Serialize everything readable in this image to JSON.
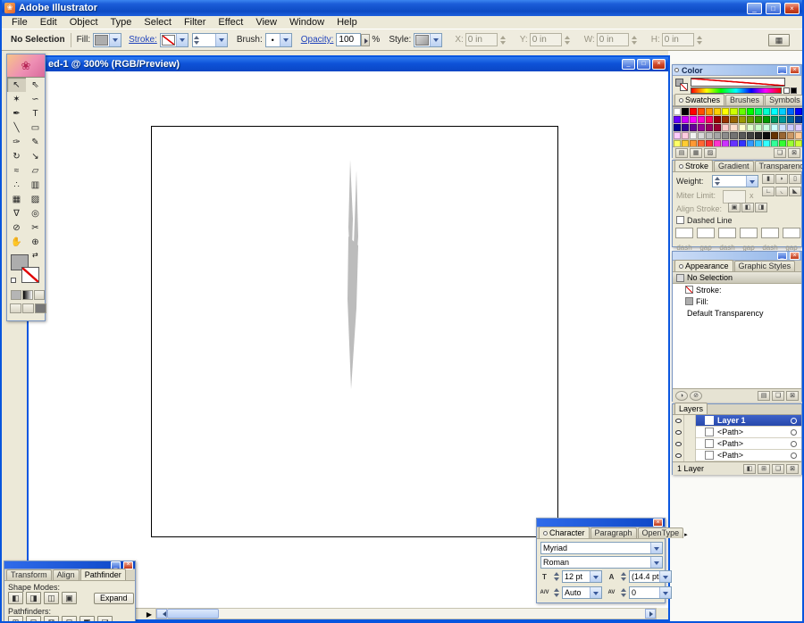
{
  "window": {
    "title": "Adobe Illustrator"
  },
  "glyphs": {
    "minimize": "_",
    "restore": "□",
    "close": "×",
    "play": "▶",
    "flower": "❀",
    "swap": "⇄",
    "panel_arrow": "▸",
    "panel": "▦"
  },
  "menu": {
    "items": [
      "File",
      "Edit",
      "Object",
      "Type",
      "Select",
      "Filter",
      "Effect",
      "View",
      "Window",
      "Help"
    ]
  },
  "control_bar": {
    "status": "No Selection",
    "fill_label": "Fill:",
    "stroke_label": "Stroke:",
    "brush_label": "Brush:",
    "brush_value": "•",
    "opacity_label": "Opacity:",
    "opacity_value": "100",
    "opacity_unit": "%",
    "style_label": "Style:",
    "fields": [
      {
        "label": "X:",
        "value": "0 in"
      },
      {
        "label": "Y:",
        "value": "0 in"
      },
      {
        "label": "W:",
        "value": "0 in"
      },
      {
        "label": "H:",
        "value": "0 in"
      }
    ]
  },
  "document": {
    "title": "ed-1 @ 300% (RGB/Preview)"
  },
  "colors": {
    "fill": "#ADADAD",
    "shape": "#BCBCBC"
  },
  "toolbox": {
    "tools": [
      {
        "name": "selection-tool-icon",
        "glyph": "↖"
      },
      {
        "name": "direct-selection-tool-icon",
        "glyph": "⇖"
      },
      {
        "name": "magic-wand-tool-icon",
        "glyph": "✶"
      },
      {
        "name": "lasso-tool-icon",
        "glyph": "∽"
      },
      {
        "name": "pen-tool-icon",
        "glyph": "✒"
      },
      {
        "name": "type-tool-icon",
        "glyph": "T"
      },
      {
        "name": "line-segment-tool-icon",
        "glyph": "╲"
      },
      {
        "name": "rectangle-tool-icon",
        "glyph": "▭"
      },
      {
        "name": "paintbrush-tool-icon",
        "glyph": "✑"
      },
      {
        "name": "pencil-tool-icon",
        "glyph": "✎"
      },
      {
        "name": "rotate-tool-icon",
        "glyph": "↻"
      },
      {
        "name": "scale-tool-icon",
        "glyph": "↘"
      },
      {
        "name": "warp-tool-icon",
        "glyph": "≈"
      },
      {
        "name": "free-transform-tool-icon",
        "glyph": "▱"
      },
      {
        "name": "symbol-sprayer-tool-icon",
        "glyph": "∴"
      },
      {
        "name": "column-graph-tool-icon",
        "glyph": "▥"
      },
      {
        "name": "mesh-tool-icon",
        "glyph": "▦"
      },
      {
        "name": "gradient-tool-icon",
        "glyph": "▨"
      },
      {
        "name": "eyedropper-tool-icon",
        "glyph": "∇"
      },
      {
        "name": "blend-tool-icon",
        "glyph": "◎"
      },
      {
        "name": "slice-tool-icon",
        "glyph": "⊘"
      },
      {
        "name": "scissors-tool-icon",
        "glyph": "✂"
      },
      {
        "name": "hand-tool-icon",
        "glyph": "✋"
      },
      {
        "name": "zoom-tool-icon",
        "glyph": "⊕"
      }
    ]
  },
  "color_panel": {
    "title": "Color"
  },
  "swatches_panel": {
    "tabs": [
      "Swatches",
      "Brushes",
      "Symbols"
    ],
    "icons": {
      "show_all": "▤",
      "show_color": "▦",
      "show_gradient": "▨",
      "new_swatch": "❏",
      "trash": "⊠"
    },
    "colors": [
      "#FFFFFF",
      "#000000",
      "#FF0000",
      "#FF4F00",
      "#FF9900",
      "#FFCE00",
      "#FFFF00",
      "#CEFF00",
      "#66FF00",
      "#00FF00",
      "#00FF66",
      "#00FFCE",
      "#00FFFF",
      "#00CEFF",
      "#0066FF",
      "#0000FF",
      "#6600FF",
      "#CE00FF",
      "#FF00FF",
      "#FF00CE",
      "#FF0066",
      "#990000",
      "#993300",
      "#996600",
      "#999900",
      "#669900",
      "#339900",
      "#009900",
      "#009966",
      "#009999",
      "#006699",
      "#003399",
      "#000099",
      "#330099",
      "#660099",
      "#990099",
      "#990066",
      "#990033",
      "#FFCCCC",
      "#FFE0CC",
      "#FFFFCC",
      "#E0FFCC",
      "#CCFFCC",
      "#CCFFE0",
      "#CCFFFF",
      "#CCE0FF",
      "#CCCCFF",
      "#E0CCFF",
      "#FFCCFF",
      "#FFCCE0",
      "#F2F2F2",
      "#D9D9D9",
      "#BFBFBF",
      "#A6A6A6",
      "#8C8C8C",
      "#737373",
      "#595959",
      "#404040",
      "#262626",
      "#0D0D0D",
      "#663300",
      "#996633",
      "#CC9966",
      "#FFCC99",
      "#FFFF66",
      "#FFCC33",
      "#FF9933",
      "#FF6633",
      "#FF3333",
      "#FF33CC",
      "#CC33FF",
      "#6633FF",
      "#3333FF",
      "#3399FF",
      "#33CCFF",
      "#33FFFF",
      "#33FF99",
      "#33FF33",
      "#99FF33",
      "#CCFF33"
    ]
  },
  "stroke_panel": {
    "tabs": [
      "Stroke",
      "Gradient",
      "Transparency"
    ],
    "weight_label": "Weight:",
    "miter_label": "Miter Limit:",
    "miter_unit": "x",
    "align_label": "Align Stroke:",
    "dashed_label": "Dashed Line",
    "dash_labels": [
      "dash",
      "gap",
      "dash",
      "gap",
      "dash",
      "gap"
    ],
    "icons": {
      "butt_cap": "▮",
      "round_cap": "◗",
      "projecting_cap": "▯",
      "miter_join": "∟",
      "round_join": "◟",
      "bevel_join": "◣",
      "align_center": "▣",
      "align_inside": "◧",
      "align_outside": "◨"
    }
  },
  "appearance_panel": {
    "tabs": [
      "Appearance",
      "Graphic Styles"
    ],
    "no_selection": "No Selection",
    "stroke_label": "Stroke:",
    "fill_label": "Fill:",
    "transparency_label": "Default Transparency",
    "icons": {
      "reduce": "◑",
      "clear": "⊘",
      "list": "▤",
      "duplicate": "❏",
      "trash": "⊠"
    }
  },
  "layers_panel": {
    "title": "Layers",
    "layer_name": "Layer 1",
    "paths": [
      "<Path>",
      "<Path>",
      "<Path>"
    ],
    "count": "1 Layer",
    "icons": {
      "clip": "◧",
      "sublayer": "⊞",
      "new_layer": "❏",
      "trash": "⊠"
    }
  },
  "character_panel": {
    "tabs": [
      "Character",
      "Paragraph",
      "OpenType"
    ],
    "font": "Myriad",
    "font_style": "Roman",
    "size": "12 pt",
    "leading": "(14.4 pt",
    "kerning": "Auto",
    "tracking": "0",
    "icons": {
      "size": "T",
      "leading": "A",
      "kerning": "A/V",
      "tracking": "AV"
    }
  },
  "pathfinder_panel": {
    "tabs": [
      "Transform",
      "Align",
      "Pathfinder"
    ],
    "shape_modes_label": "Shape Modes:",
    "expand_label": "Expand",
    "pathfinders_label": "Pathfinders:",
    "shape_mode_icons": [
      "◧",
      "◨",
      "◫",
      "▣"
    ],
    "pathfinder_icons": [
      "⊞",
      "⊟",
      "⊠",
      "⊡",
      "◩",
      "◪"
    ]
  }
}
